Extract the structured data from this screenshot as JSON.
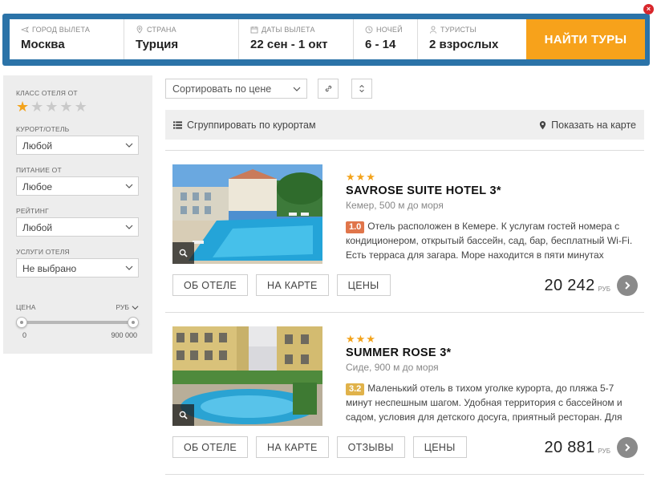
{
  "search": {
    "city": {
      "label": "Город вылета",
      "value": "Москва"
    },
    "country": {
      "label": "Страна",
      "value": "Турция"
    },
    "dates": {
      "label": "Даты вылета",
      "value": "22 сен - 1 окт"
    },
    "nights": {
      "label": "Ночей",
      "value": "6 - 14"
    },
    "tourists": {
      "label": "Туристы",
      "value": "2 взрослых"
    },
    "find_label": "НАЙТИ ТУРЫ",
    "close_glyph": "×"
  },
  "filters": {
    "hotel_class_label": "Класс отеля от",
    "hotel_class_selected": 1,
    "resort": {
      "label": "Курорт/отель",
      "value": "Любой"
    },
    "meal": {
      "label": "Питание от",
      "value": "Любое"
    },
    "rating": {
      "label": "Рейтинг",
      "value": "Любой"
    },
    "services": {
      "label": "Услуги отеля",
      "value": "Не выбрано"
    },
    "price": {
      "label": "Цена",
      "currency": "РУБ",
      "min": "0",
      "max": "900 000"
    }
  },
  "controls": {
    "sort_value": "Сортировать по цене",
    "group_label": "Сгруппировать по курортам",
    "map_label": "Показать на карте"
  },
  "hotels": [
    {
      "stars": "★★★",
      "name": "SAVROSE SUITE HOTEL 3*",
      "location": "Кемер, 500 м до моря",
      "rating": "1.0",
      "rating_color": "#e0754a",
      "description": "Отель расположен в Кемере. К услугам гостей номера с кондиционером, открытый бассейн, сад, бар, бесплатный Wi-Fi. Есть терраса для загара. Море находится в пяти минутах",
      "buttons": [
        "ОБ ОТЕЛЕ",
        "НА КАРТЕ",
        "ЦЕНЫ"
      ],
      "price": "20 242",
      "currency": "РУБ"
    },
    {
      "stars": "★★★",
      "name": "SUMMER ROSE 3*",
      "location": "Сиде, 900 м до моря",
      "rating": "3.2",
      "rating_color": "#e0b24a",
      "description": "Маленький отель в тихом уголке курорта, до пляжа 5-7 минут неспешным шагом. Удобная территория с бассейном и садом, условия для детского досуга, приятный ресторан. Для",
      "buttons": [
        "ОБ ОТЕЛЕ",
        "НА КАРТЕ",
        "ОТЗЫВЫ",
        "ЦЕНЫ"
      ],
      "price": "20 881",
      "currency": "РУБ"
    }
  ],
  "colors": {
    "accent": "#f7a21b",
    "frame": "#2b73a8",
    "star": "#f3a31c"
  }
}
